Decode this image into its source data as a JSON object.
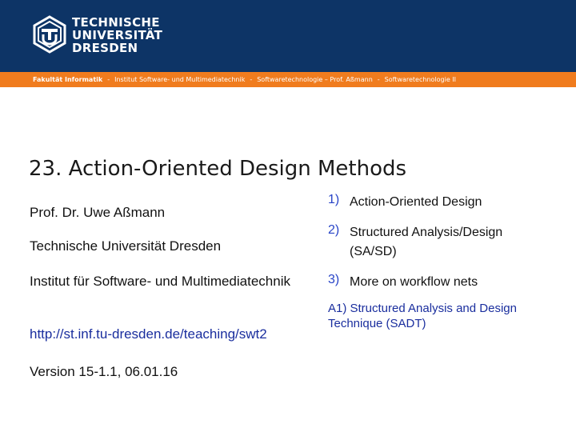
{
  "header": {
    "logo_text": [
      "TECHNISCHE",
      "UNIVERSITÄT",
      "DRESDEN"
    ]
  },
  "navbar": {
    "faculty": "Fakultät Informatik",
    "items": [
      "Institut Software- und Multimediatechnik",
      "Softwaretechnologie – Prof. Aßmann",
      "Softwaretechnologie II"
    ]
  },
  "slide": {
    "title": "23. Action-Oriented Design Methods",
    "author": "Prof. Dr. Uwe Aßmann",
    "university": "Technische Universität Dresden",
    "institute": "Institut für Software- und Multimediatechnik",
    "url": "http://st.inf.tu-dresden.de/teaching/swt2",
    "version": "Version 15-1.1, 06.01.16"
  },
  "toc": [
    {
      "num": "1)",
      "text": "Action-Oriented Design"
    },
    {
      "num": "2)",
      "text": "Structured Analysis/Design (SA/SD)"
    },
    {
      "num": "3)",
      "text": "More on workflow nets"
    }
  ],
  "appendix": "A1) Structured Analysis and Design Technique (SADT)",
  "colors": {
    "header_bg": "#0d3466",
    "navbar_bg": "#f07c1e",
    "link": "#1a2e9e",
    "list_number": "#2844c7"
  },
  "icons": [
    "tu-dresden-logo-icon"
  ]
}
